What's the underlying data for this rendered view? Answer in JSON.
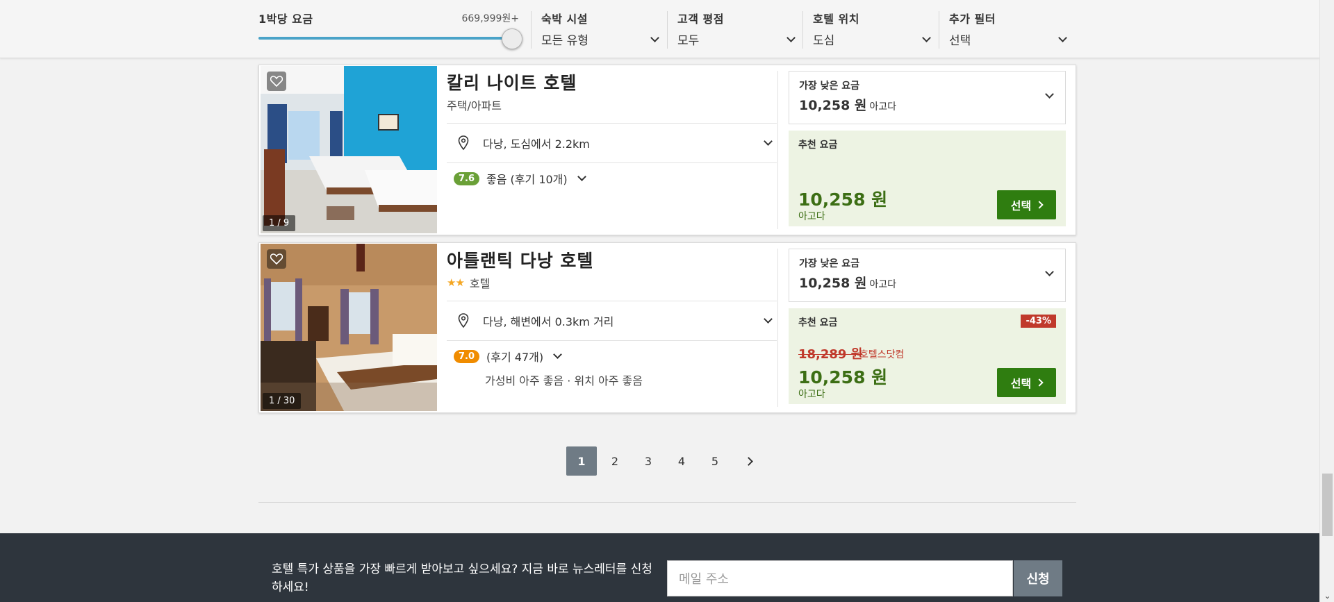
{
  "filters": {
    "price": {
      "label": "1박당 요금",
      "max": "669,999원+",
      "level_percent": 100
    },
    "accommodation": {
      "label": "숙박 시설",
      "value": "모든 유형"
    },
    "rating": {
      "label": "고객 평점",
      "value": "모두"
    },
    "location": {
      "label": "호텔 위치",
      "value": "도심"
    },
    "more": {
      "label": "추가 필터",
      "value": "선택"
    }
  },
  "hotels": [
    {
      "name": "칼리 나이트 호텔",
      "type": "주택/아파트",
      "stars": 0,
      "location": "다낭, 도심에서 2.2km",
      "score": "7.6",
      "rating_text": "좋음 (후기 10개)",
      "tags": "",
      "photo_counter": "1 / 9",
      "lowest_label": "가장 낮은 요금",
      "lowest_price": "10,258 원",
      "lowest_source": "아고다",
      "rec_label": "추천 요금",
      "rec_price": "10,258 원",
      "rec_source": "아고다",
      "select_label": "선택"
    },
    {
      "name": "아틀랜틱 다낭 호텔",
      "type": "호텔",
      "stars": 2,
      "location": "다낭, 해변에서 0.3km 거리",
      "score": "7.0",
      "rating_text": "(후기 47개)",
      "tags": "가성비 아주 좋음 · 위치 아주 좋음",
      "photo_counter": "1 / 30",
      "lowest_label": "가장 낮은 요금",
      "lowest_price": "10,258 원",
      "lowest_source": "아고다",
      "rec_label": "추천 요금",
      "old_price": "18,289 원",
      "old_source": "호텔스닷컴",
      "discount": "-43%",
      "rec_price": "10,258 원",
      "rec_source": "아고다",
      "select_label": "선택"
    }
  ],
  "pagination": {
    "pages": [
      "1",
      "2",
      "3",
      "4",
      "5"
    ],
    "current": "1"
  },
  "newsletter": {
    "text": "호텔 특가 상품을 가장 빠르게 받아보고 싶으세요? 지금 바로 뉴스레터를 신청하세요!",
    "placeholder": "메일 주소",
    "button": "신청"
  },
  "colors": {
    "accent_green": "#2f7d10",
    "discount_red": "#c0392b",
    "slider_blue": "#4aa3c8",
    "footer_bg": "#2e353d"
  }
}
